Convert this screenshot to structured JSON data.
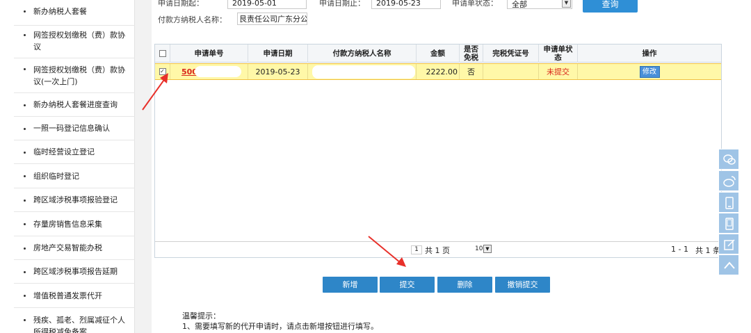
{
  "sidebar": {
    "items": [
      {
        "label": "新办纳税人套餐"
      },
      {
        "label": "网签授权划缴税（费）款协议"
      },
      {
        "label": "网签授权划缴税（费）款协议(一次上门)"
      },
      {
        "label": "新办纳税人套餐进度查询"
      },
      {
        "label": "一照一码登记信息确认"
      },
      {
        "label": "临时经营设立登记"
      },
      {
        "label": "组织临时登记"
      },
      {
        "label": "跨区域涉税事项报验登记"
      },
      {
        "label": "存量房销售信息采集"
      },
      {
        "label": "房地产交易智能办税"
      },
      {
        "label": "跨区域涉税事项报告延期"
      },
      {
        "label": "增值税普通发票代开"
      },
      {
        "label": "残疾、孤老、烈属减征个人所得税减免备案"
      }
    ]
  },
  "filter": {
    "date_start_label": "申请日期起：",
    "date_start_value": "2019-05-01",
    "date_end_label": "申请日期止：",
    "date_end_value": "2019-05-23",
    "status_label": "申请单状态：",
    "status_value": "全部",
    "query_button": "查询",
    "payer_label": "付款方纳税人名称：",
    "payer_value": "艮责任公司广东分公司"
  },
  "table": {
    "headers": {
      "checkbox": "",
      "app_no": "申请单号",
      "app_date": "申请日期",
      "payer_name": "付款方纳税人名称",
      "amount": "金额",
      "tax_free": "是否免税",
      "voucher_no": "完税凭证号",
      "status": "申请单状态",
      "operation": "操作"
    },
    "rows": [
      {
        "checked": "✓",
        "app_no": "500",
        "app_date": "2019-05-23",
        "payer_name": "",
        "amount": "2222.00",
        "tax_free": "否",
        "voucher_no": "",
        "status": "未提交",
        "edit_button": "修改"
      }
    ]
  },
  "pager": {
    "page_input": "1",
    "total_pages": "共 1 页",
    "page_size": "10",
    "record_range": "1 - 1",
    "total_records": "共 1 条"
  },
  "actions": {
    "add": "新增",
    "submit": "提交",
    "delete": "删除",
    "revoke": "撤销提交"
  },
  "tips": {
    "title": "温馨提示：",
    "line1": "1、需要填写新的代开申请时，请点击新增按钮进行填写。"
  },
  "colors": {
    "primary": "#2e86c8",
    "highlight_row": "#fff8a8",
    "status_red": "#d9261c",
    "annotation_arrow": "#e8302a",
    "float_bar": "#9fc4e6"
  }
}
